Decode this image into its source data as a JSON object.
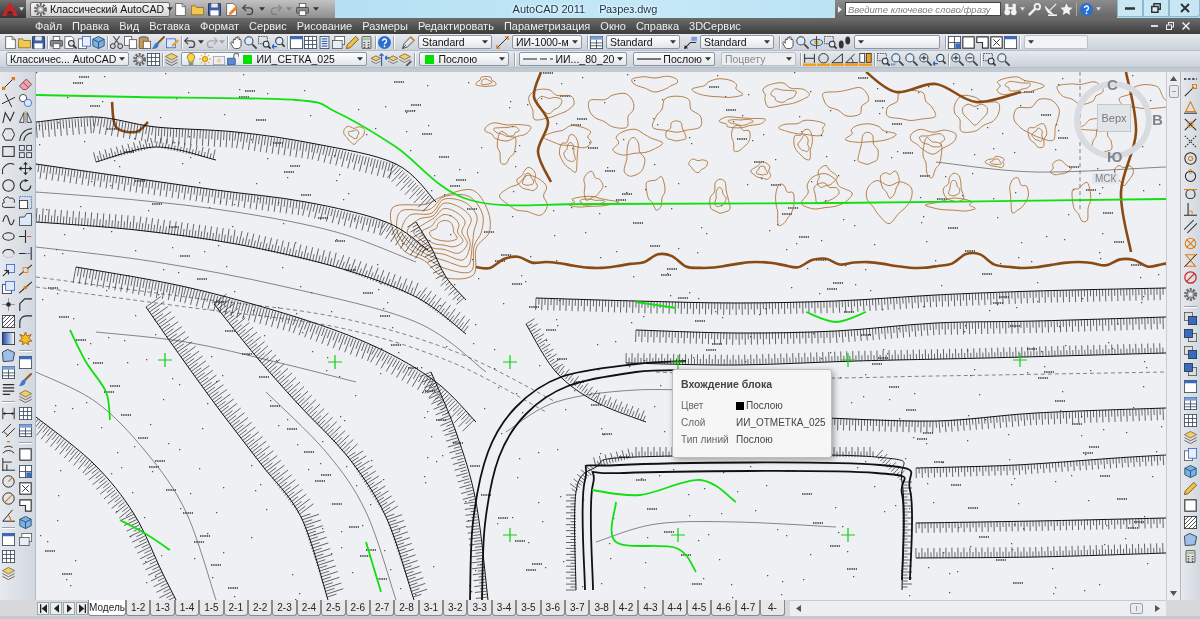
{
  "title_bar": {
    "workspace": "Классический AutoCAD",
    "redo": {
      "disabled": true
    },
    "title": "AutoCAD 2011",
    "document": "Разрез.dwg",
    "search": {
      "placeholder": "Введите ключевое слово/фразу"
    }
  },
  "menu_bar": {
    "items": [
      "Файл",
      "Правка",
      "Вид",
      "Вставка",
      "Формат",
      "Сервис",
      "Рисование",
      "Размеры",
      "Редактировать",
      "Параметризация",
      "Окно",
      "Справка",
      "3DСервис"
    ]
  },
  "standard_toolbar": {
    "redo": {
      "disabled": true
    },
    "text_style": "Standard",
    "dimension_style": "ИИ-1000-м",
    "table_style": "Standard",
    "multileader_style": "Standard"
  },
  "layers_toolbar": {
    "workspace": "Классичес... AutoCAD",
    "layer": {
      "name": "ИИ_СЕТКА_025",
      "on": true,
      "frozen": false,
      "locked": false,
      "color": "#00e000"
    },
    "color": {
      "label": "Послою",
      "color": "#00e000"
    },
    "linetype": "ИИ..._80_20",
    "lineweight": "Послою",
    "plot_style": {
      "label": "Поцвету",
      "disabled": true
    }
  },
  "drawing": {
    "view_cube": {
      "north": "С",
      "top": "Верх",
      "east": "В",
      "south": "Ю",
      "ucs": "МСК"
    },
    "tooltip": {
      "title": "Вхождение блока",
      "rows": [
        {
          "label": "Цвет",
          "value": "Послою",
          "color": "#000000"
        },
        {
          "label": "Слой",
          "value": "ИИ_ОТМЕТКА_025"
        },
        {
          "label": "Тип линий",
          "value": "Послою"
        }
      ]
    }
  },
  "layout_tabs": [
    {
      "label": "Модель",
      "selected": true
    },
    {
      "label": "1-2",
      "selected": false
    },
    {
      "label": "1-3",
      "selected": false
    },
    {
      "label": "1-4",
      "selected": false
    },
    {
      "label": "1-5",
      "selected": false
    },
    {
      "label": "2-1",
      "selected": false
    },
    {
      "label": "2-2",
      "selected": false
    },
    {
      "label": "2-3",
      "selected": false
    },
    {
      "label": "2-4",
      "selected": false
    },
    {
      "label": "2-5",
      "selected": false
    },
    {
      "label": "2-6",
      "selected": false
    },
    {
      "label": "2-7",
      "selected": false
    },
    {
      "label": "2-8",
      "selected": false
    },
    {
      "label": "3-1",
      "selected": false
    },
    {
      "label": "3-2",
      "selected": false
    },
    {
      "label": "3-3",
      "selected": false
    },
    {
      "label": "3-4",
      "selected": false
    },
    {
      "label": "3-5",
      "selected": false
    },
    {
      "label": "3-6",
      "selected": false
    },
    {
      "label": "3-7",
      "selected": false
    },
    {
      "label": "3-8",
      "selected": false
    },
    {
      "label": "4-2",
      "selected": false
    },
    {
      "label": "4-3",
      "selected": false
    },
    {
      "label": "4-4",
      "selected": false
    },
    {
      "label": "4-5",
      "selected": false
    },
    {
      "label": "4-6",
      "selected": false
    },
    {
      "label": "4-7",
      "selected": false
    },
    {
      "label": "4-",
      "selected": false
    }
  ]
}
